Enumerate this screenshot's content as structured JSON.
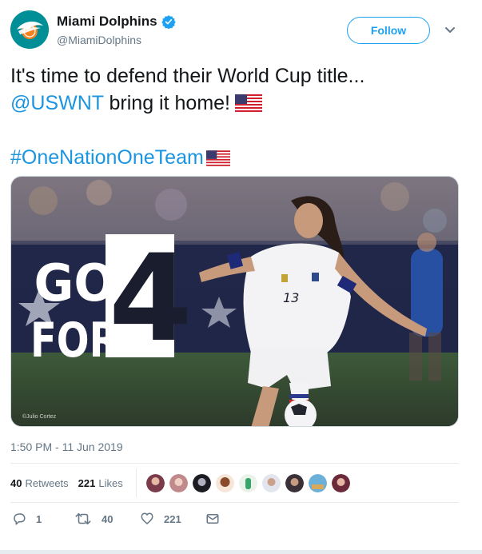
{
  "account": {
    "name": "Miami Dolphins",
    "handle": "@MiamiDolphins",
    "follow_label": "Follow"
  },
  "tweet": {
    "line1": "It's time to defend their World Cup title...",
    "mention": "@USWNT",
    "line2_rest": " bring it home!",
    "hashtag": "#OneNationOneTeam",
    "timestamp": "1:50 PM - 11 Jun 2019"
  },
  "media": {
    "headline_line1": "GO",
    "headline_line2": "FOR",
    "headline_number": "4",
    "jersey_number": "13",
    "photo_credit": "©Julio Cortez"
  },
  "stats": {
    "retweets_count": "40",
    "retweets_label": "Retweets",
    "likes_count": "221",
    "likes_label": "Likes"
  },
  "actions": {
    "reply_count": "1",
    "retweet_count": "40",
    "like_count": "221"
  },
  "colors": {
    "link": "#1b95e0",
    "follow": "#1da1f2",
    "muted": "#657786",
    "dolphins_aqua": "#008e97"
  },
  "icons": [
    "dolphins-logo-icon",
    "verified-badge-icon",
    "chevron-down-icon",
    "us-flag-icon",
    "reply-icon",
    "retweet-icon",
    "like-icon",
    "message-icon"
  ]
}
